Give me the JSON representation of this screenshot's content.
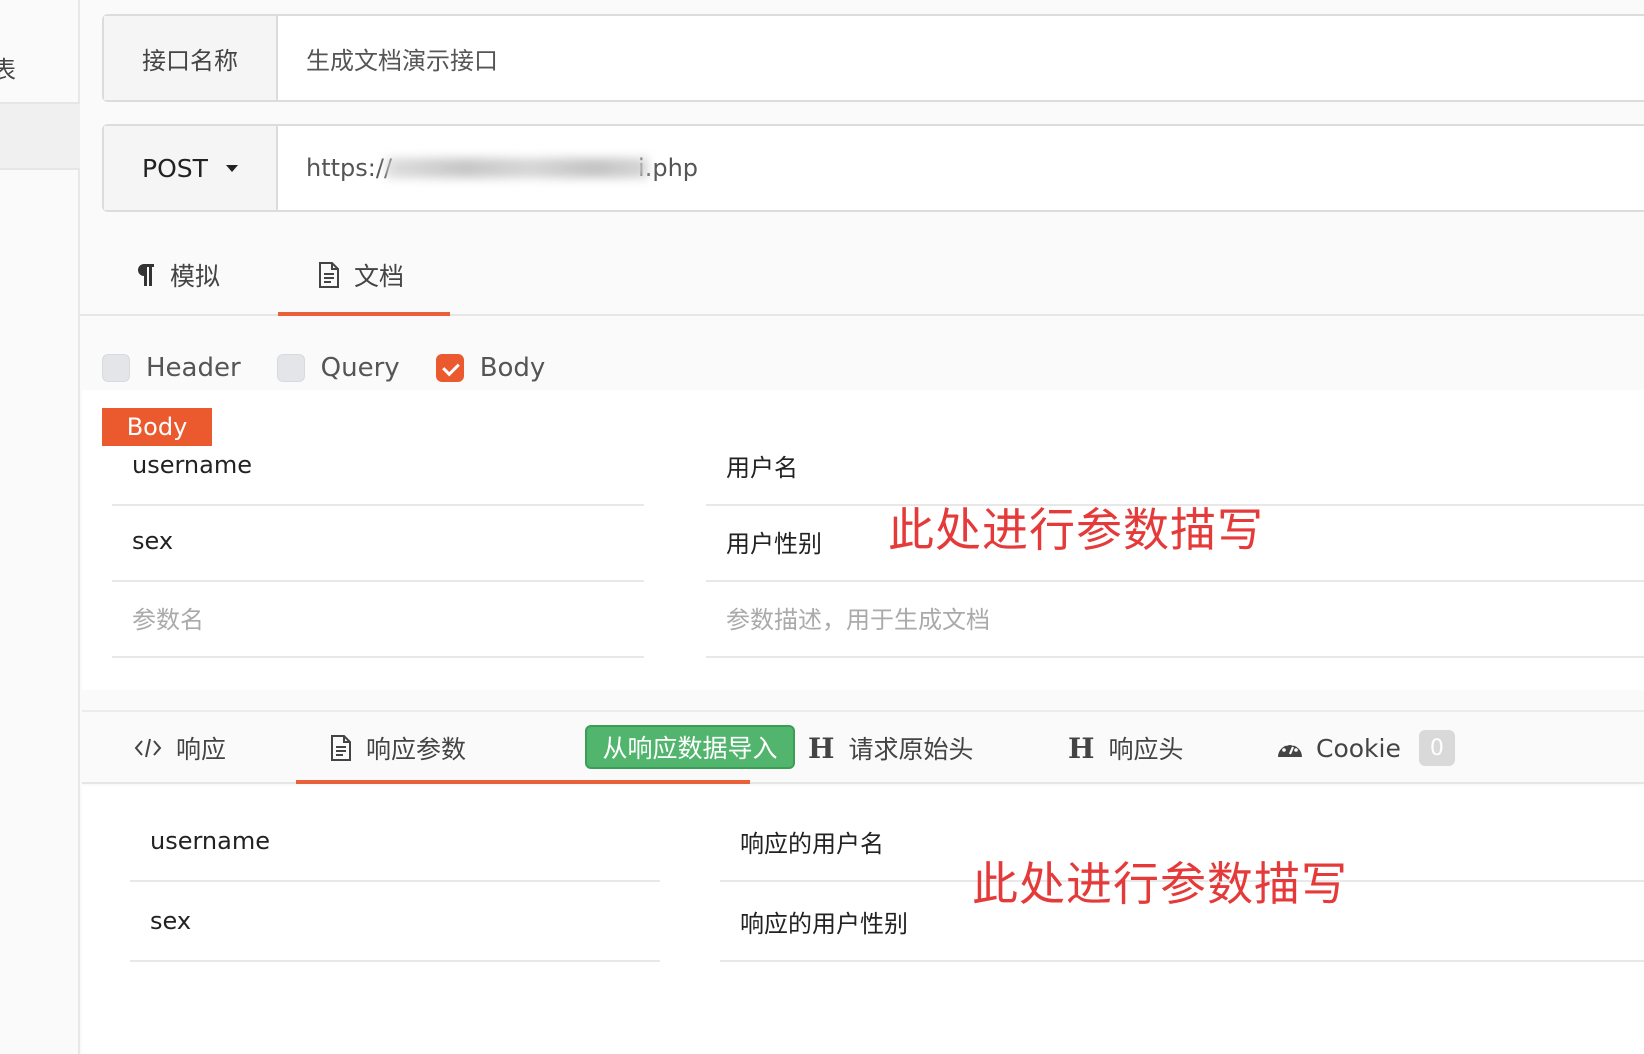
{
  "sidebar": {
    "label": "表"
  },
  "api": {
    "name_label": "接口名称",
    "name_value": "生成文档演示接口",
    "method": "POST",
    "url_prefix": "https://",
    "url_suffix": "i.php"
  },
  "tabs": {
    "mock": "模拟",
    "doc": "文档"
  },
  "checks": [
    {
      "label": "Header",
      "checked": false
    },
    {
      "label": "Query",
      "checked": false
    },
    {
      "label": "Body",
      "checked": true
    }
  ],
  "body": {
    "tag": "Body",
    "params": [
      {
        "name": "username",
        "desc": "用户名"
      },
      {
        "name": "sex",
        "desc": "用户性别"
      }
    ],
    "placeholder_name": "参数名",
    "placeholder_desc": "参数描述，用于生成文档"
  },
  "annotation": "此处进行参数描写",
  "response_tabs": {
    "response": "响应",
    "response_params": "响应参数",
    "import_button": "从响应数据导入",
    "raw_request_headers": "请求原始头",
    "response_headers": "响应头",
    "cookie": "Cookie",
    "cookie_count": "0"
  },
  "response": {
    "params": [
      {
        "name": "username",
        "desc": "响应的用户名"
      },
      {
        "name": "sex",
        "desc": "响应的用户性别"
      }
    ]
  },
  "colors": {
    "accent": "#ea5a2e",
    "green": "#52b56d",
    "annotation": "#e53a3a"
  },
  "icons": [
    "paragraph-icon",
    "document-icon",
    "code-icon",
    "header-icon",
    "dashboard-icon"
  ]
}
